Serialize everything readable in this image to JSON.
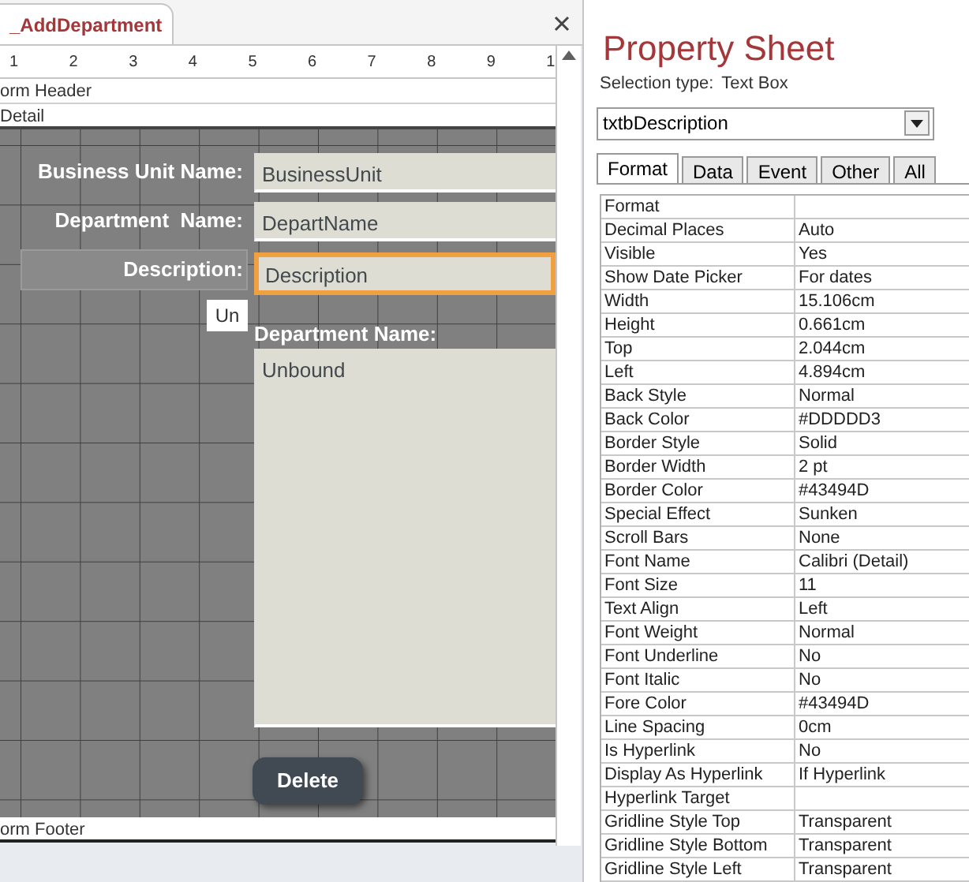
{
  "document_tab": {
    "title": "_AddDepartment",
    "selected": true
  },
  "ruler": [
    "1",
    "2",
    "3",
    "4",
    "5",
    "6",
    "7",
    "8",
    "9",
    "1"
  ],
  "sections": {
    "header": "orm Header",
    "detail": "Detail",
    "footer": "orm Footer"
  },
  "controls": [
    {
      "kind": "label",
      "text": "Business Unit Name:"
    },
    {
      "kind": "textbox",
      "text": "BusinessUnit",
      "selected": false
    },
    {
      "kind": "label",
      "text": "Department  Name:"
    },
    {
      "kind": "textbox",
      "text": "DepartName",
      "selected": false
    },
    {
      "kind": "label",
      "text": "Description:",
      "selected": true
    },
    {
      "kind": "textbox",
      "text": "Description",
      "selected": true
    },
    {
      "kind": "tag",
      "text": "Un"
    },
    {
      "kind": "label",
      "text": "Department Name:"
    },
    {
      "kind": "textbox",
      "text": "Unbound",
      "selected": false
    },
    {
      "kind": "button",
      "text": "Delete"
    }
  ],
  "property_sheet": {
    "title": "Property Sheet",
    "selection_type_label": "Selection type:",
    "selection_type": "Text Box",
    "object": "txtbDescription",
    "tabs": [
      {
        "label": "Format",
        "selected": true
      },
      {
        "label": "Data",
        "selected": false
      },
      {
        "label": "Event",
        "selected": false
      },
      {
        "label": "Other",
        "selected": false
      },
      {
        "label": "All",
        "selected": false
      }
    ],
    "properties": [
      {
        "name": "Format"
      },
      {
        "name": "Decimal Places",
        "value": "Auto"
      },
      {
        "name": "Visible",
        "value": "Yes"
      },
      {
        "name": "Show Date Picker",
        "value": "For dates"
      },
      {
        "name": "Width",
        "value": "15.106cm"
      },
      {
        "name": "Height",
        "value": "0.661cm"
      },
      {
        "name": "Top",
        "value": "2.044cm"
      },
      {
        "name": "Left",
        "value": "4.894cm"
      },
      {
        "name": "Back Style",
        "value": "Normal"
      },
      {
        "name": "Back Color",
        "value": "#DDDDD3"
      },
      {
        "name": "Border Style",
        "value": "Solid"
      },
      {
        "name": "Border Width",
        "value": "2 pt"
      },
      {
        "name": "Border Color",
        "value": "#43494D"
      },
      {
        "name": "Special Effect",
        "value": "Sunken"
      },
      {
        "name": "Scroll Bars",
        "value": "None"
      },
      {
        "name": "Font Name",
        "value": "Calibri (Detail)"
      },
      {
        "name": "Font Size",
        "value": "11"
      },
      {
        "name": "Text Align",
        "value": "Left"
      },
      {
        "name": "Font Weight",
        "value": "Normal"
      },
      {
        "name": "Font Underline",
        "value": "No"
      },
      {
        "name": "Font Italic",
        "value": "No"
      },
      {
        "name": "Fore Color",
        "value": "#43494D"
      },
      {
        "name": "Line Spacing",
        "value": "0cm"
      },
      {
        "name": "Is Hyperlink",
        "value": "No"
      },
      {
        "name": "Display As Hyperlink",
        "value": "If Hyperlink"
      },
      {
        "name": "Hyperlink Target"
      },
      {
        "name": "Gridline Style Top",
        "value": "Transparent"
      },
      {
        "name": "Gridline Style Bottom",
        "value": "Transparent"
      },
      {
        "name": "Gridline Style Left",
        "value": "Transparent"
      }
    ]
  }
}
